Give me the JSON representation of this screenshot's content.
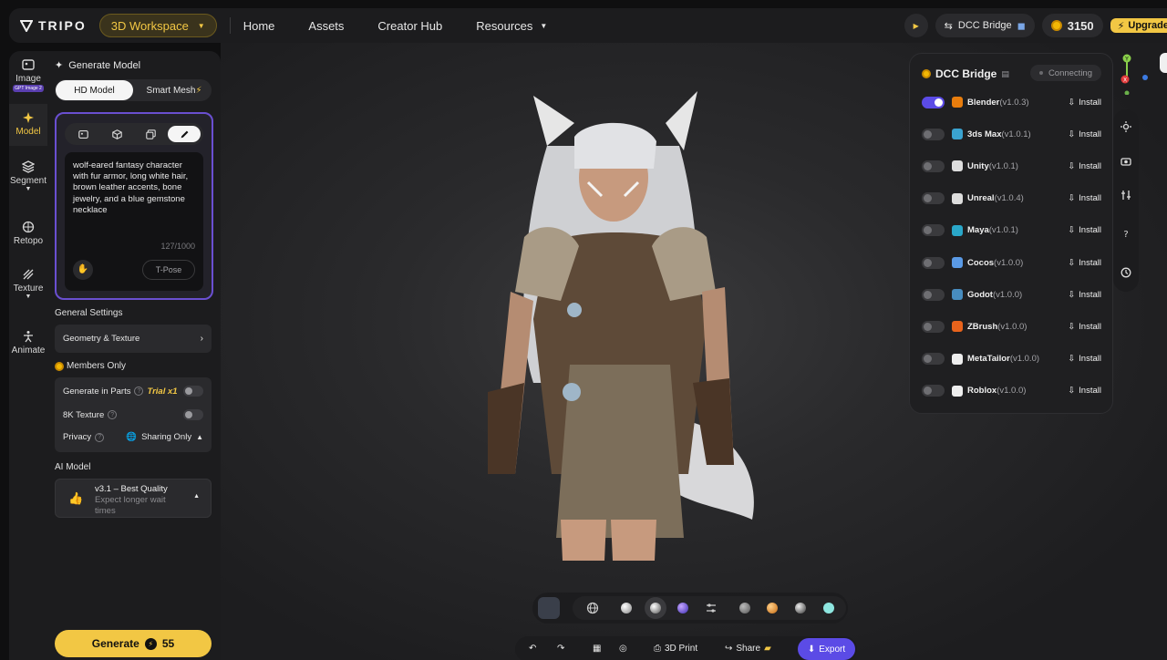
{
  "topbar": {
    "logo_text": "TRIPO",
    "workspace_label": "3D Workspace",
    "nav": [
      "Home",
      "Assets",
      "Creator Hub",
      "Resources"
    ],
    "dcc_bridge_label": "DCC Bridge",
    "credits": "3150",
    "upgrade_label": "Upgrade"
  },
  "leftnav": {
    "items": [
      {
        "label": "Image",
        "badge": "GPT Image 2"
      },
      {
        "label": "Model"
      },
      {
        "label": "Segment"
      },
      {
        "label": "Retopo"
      },
      {
        "label": "Texture"
      },
      {
        "label": "Animate"
      }
    ]
  },
  "panel": {
    "title": "Generate Model",
    "mode_hd": "HD Model",
    "mode_smart": "Smart Mesh",
    "prompt": "wolf-eared fantasy character with fur armor, long white hair, brown leather accents, bone jewelry, and a blue gemstone necklace",
    "counter": "127/1000",
    "tpose": "T-Pose",
    "general_settings": "General Settings",
    "geometry_texture": "Geometry & Texture",
    "members_only": "Members Only",
    "gen_parts": "Generate in Parts",
    "trial": "Trial x1",
    "texture_8k": "8K Texture",
    "privacy": "Privacy",
    "privacy_value": "Sharing Only",
    "ai_model_label": "AI Model",
    "ai_model_name": "v3.1 – Best Quality",
    "ai_model_desc": "Expect longer wait times",
    "generate_label": "Generate",
    "generate_cost": "55"
  },
  "dcc": {
    "title": "DCC Bridge",
    "status": "Connecting",
    "apps": [
      {
        "name": "Blender",
        "version": "(v1.0.3)",
        "enabled": true,
        "color": "#e87d0d"
      },
      {
        "name": "3ds Max",
        "version": "(v1.0.1)",
        "enabled": false,
        "color": "#3aa3d0"
      },
      {
        "name": "Unity",
        "version": "(v1.0.1)",
        "enabled": false,
        "color": "#dddddd"
      },
      {
        "name": "Unreal",
        "version": "(v1.0.4)",
        "enabled": false,
        "color": "#dddddd"
      },
      {
        "name": "Maya",
        "version": "(v1.0.1)",
        "enabled": false,
        "color": "#2aa7c9"
      },
      {
        "name": "Cocos",
        "version": "(v1.0.0)",
        "enabled": false,
        "color": "#5a9ae6"
      },
      {
        "name": "Godot",
        "version": "(v1.0.0)",
        "enabled": false,
        "color": "#478cbf"
      },
      {
        "name": "ZBrush",
        "version": "(v1.0.0)",
        "enabled": false,
        "color": "#e8631c"
      },
      {
        "name": "MetaTailor",
        "version": "(v1.0.0)",
        "enabled": false,
        "color": "#eeeeee"
      },
      {
        "name": "Roblox",
        "version": "(v1.0.0)",
        "enabled": false,
        "color": "#eeeeee"
      }
    ],
    "install_label": "Install"
  },
  "actions": {
    "print": "3D Print",
    "share": "Share",
    "export": "Export"
  }
}
